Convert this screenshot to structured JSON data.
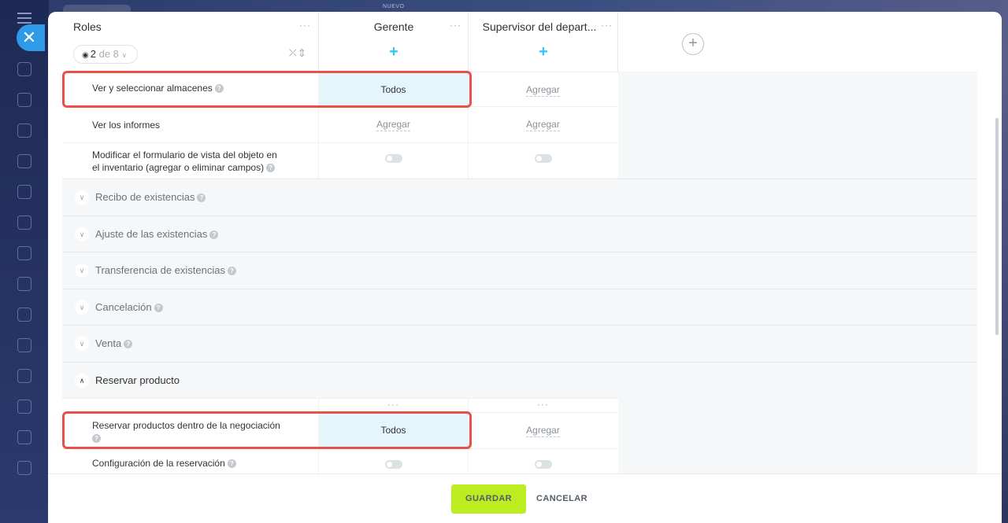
{
  "header": {
    "badge": "NUEVO"
  },
  "table": {
    "roles_title": "Roles",
    "counter": {
      "current": "2",
      "of_label": "de 8"
    },
    "columns": [
      {
        "name": "Gerente"
      },
      {
        "name": "Supervisor del depart..."
      }
    ],
    "rows_top": [
      {
        "label": "Ver y seleccionar almacenes",
        "values": [
          "Todos",
          "Agregar"
        ]
      },
      {
        "label": "Ver los informes",
        "values": [
          "Agregar",
          "Agregar"
        ]
      },
      {
        "label_line1": "Modificar el formulario de vista del objeto en",
        "label_line2": "el inventario (agregar o eliminar campos)"
      }
    ],
    "sections": [
      {
        "title": "Recibo de existencias"
      },
      {
        "title": "Ajuste de las existencias"
      },
      {
        "title": "Transferencia de existencias"
      },
      {
        "title": "Cancelación"
      },
      {
        "title": "Venta"
      },
      {
        "title": "Reservar producto"
      }
    ],
    "rows_bottom": [
      {
        "label": "Reservar productos dentro de la negociación",
        "values": [
          "Todos",
          "Agregar"
        ]
      },
      {
        "label": "Configuración de la reservación"
      }
    ]
  },
  "footer": {
    "save_label": "GUARDAR",
    "cancel_label": "CANCELAR"
  },
  "colors": {
    "accent": "#2fc6f6",
    "save_bg": "#bbed21",
    "highlight": "#e5f5fc",
    "annotation_red": "#e8504a"
  }
}
